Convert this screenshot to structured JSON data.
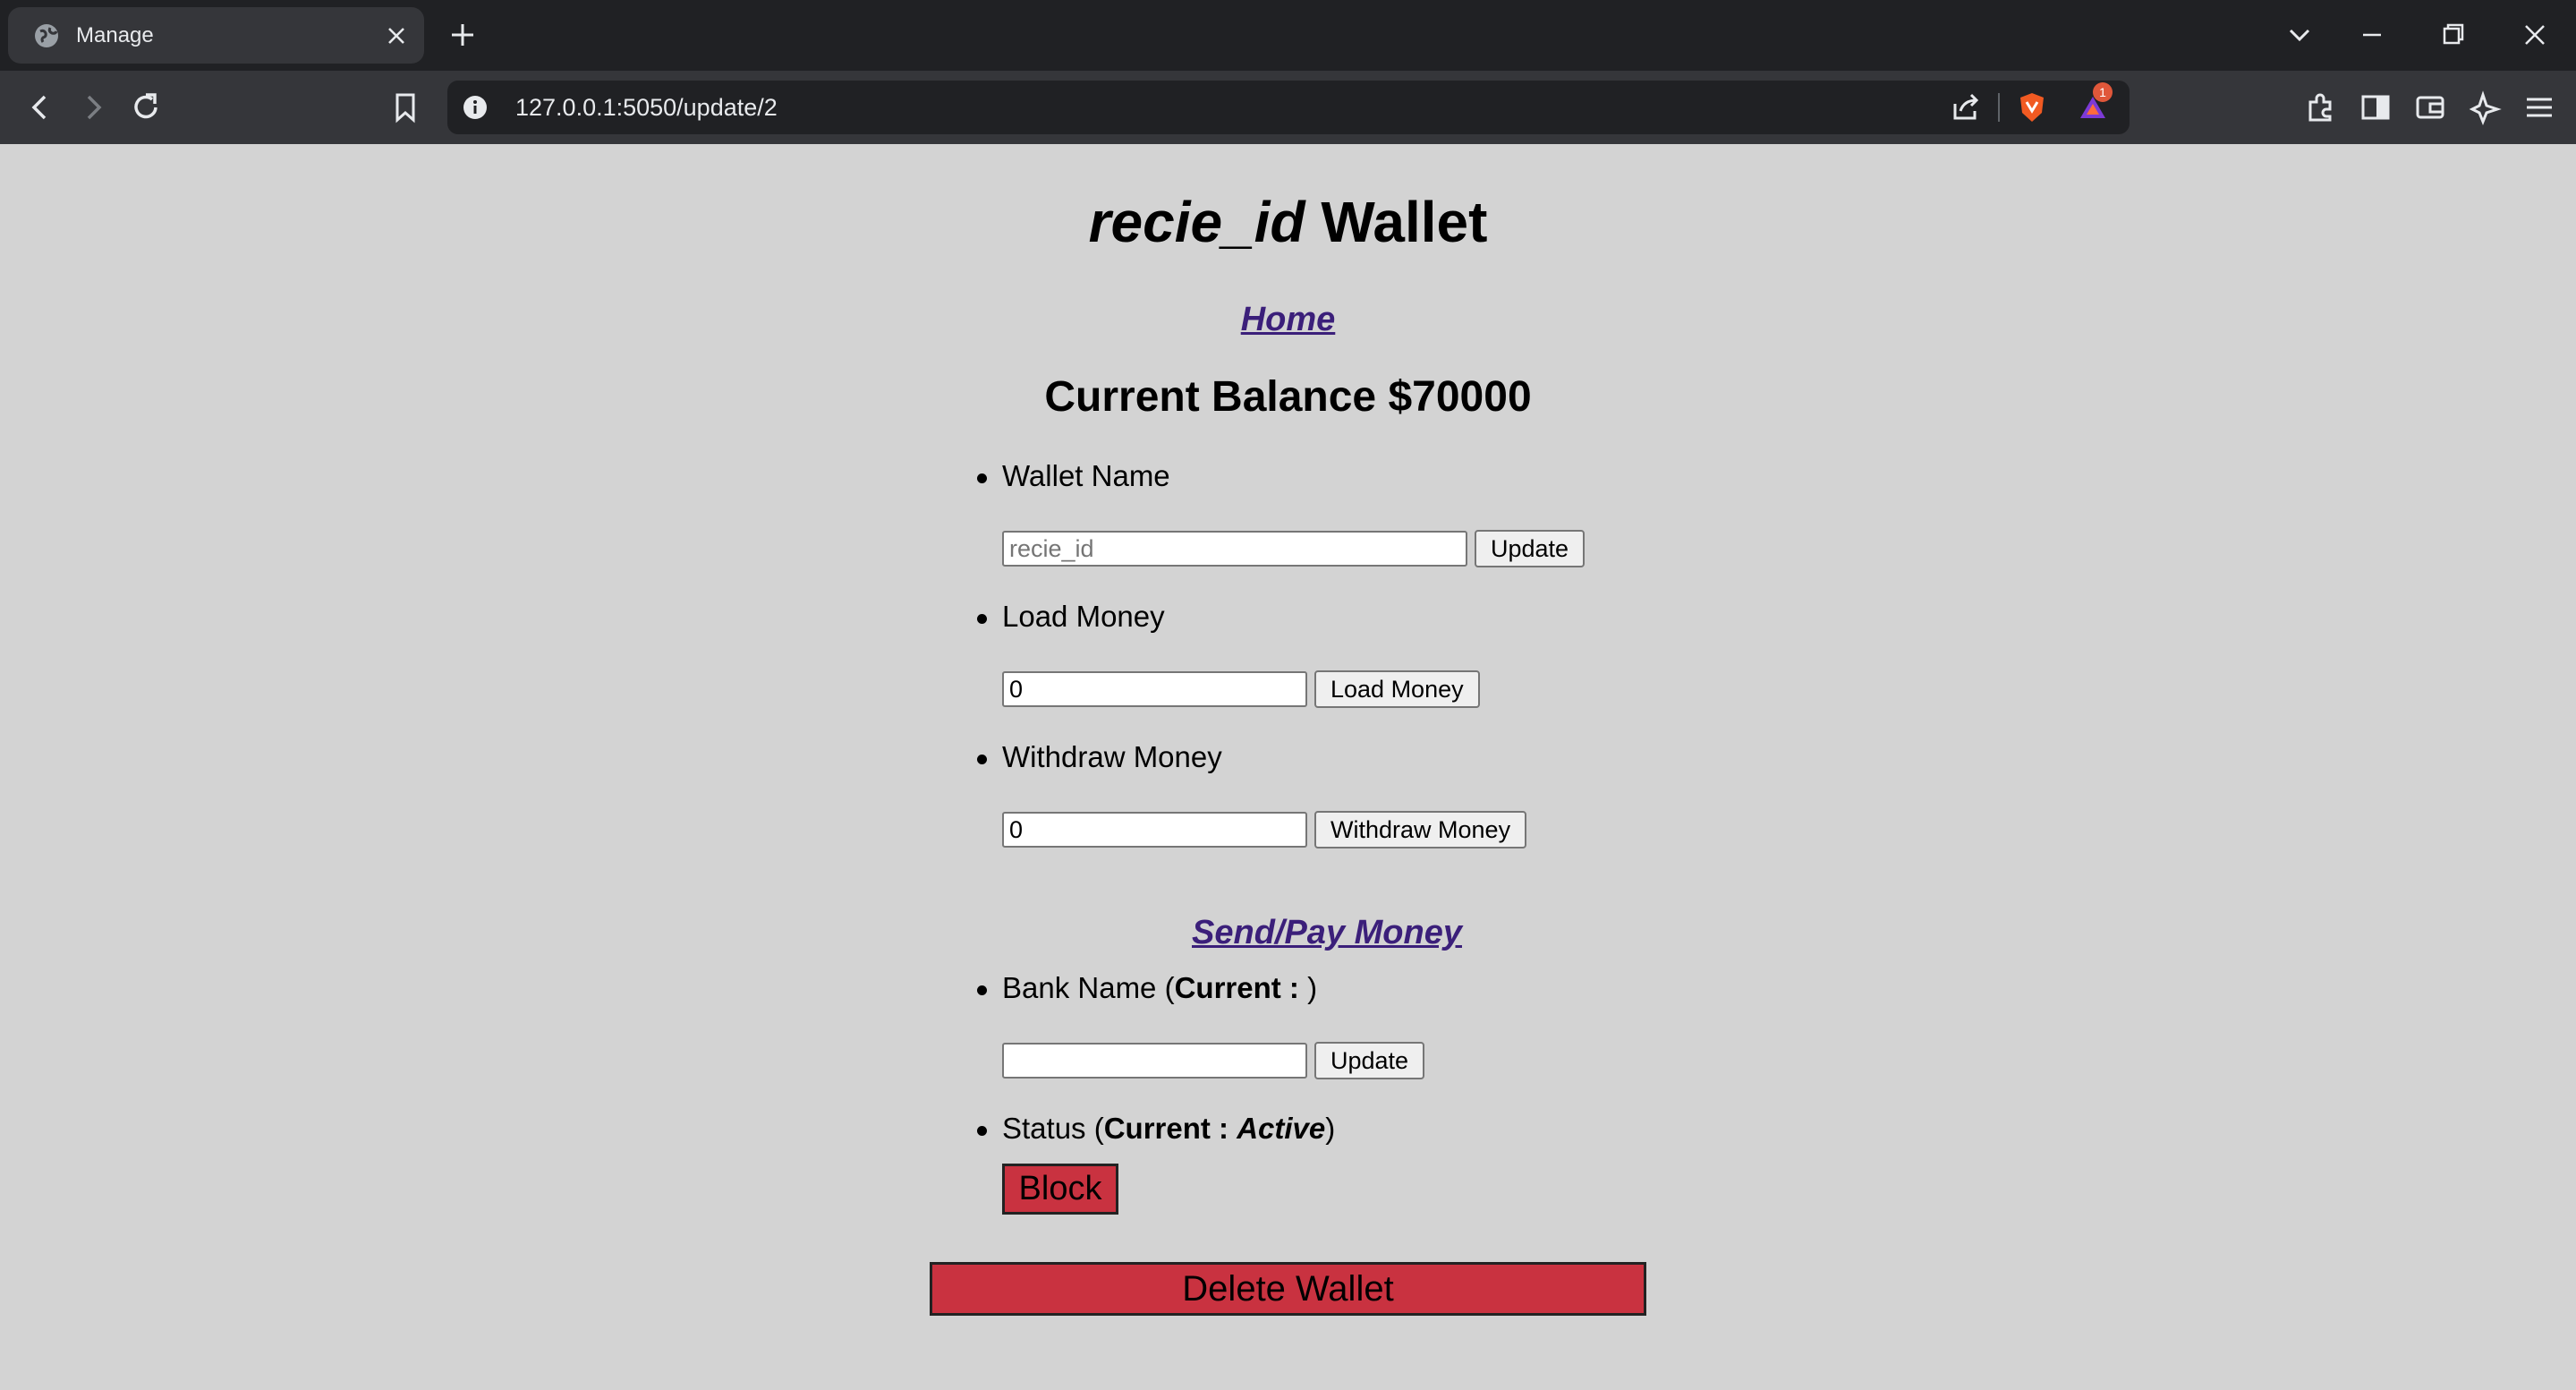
{
  "browser": {
    "tab_title": "Manage",
    "url": "127.0.0.1:5050/update/2",
    "notification_badge": "1"
  },
  "page": {
    "wallet_name": "recie_id",
    "title_suffix": "Wallet",
    "home_link": "Home",
    "balance_text": "Current Balance $70000",
    "wallet_name_section": {
      "label": "Wallet Name",
      "placeholder": "recie_id",
      "button": "Update"
    },
    "load_money_section": {
      "label": "Load Money",
      "value": "0",
      "button": "Load Money"
    },
    "withdraw_money_section": {
      "label": "Withdraw Money",
      "value": "0",
      "button": "Withdraw Money"
    },
    "send_pay_link": "Send/Pay Money",
    "bank_name_section": {
      "label": "Bank Name (",
      "current_label": "Current : ",
      "current_value": "",
      "closing": ")",
      "value": "",
      "button": "Update"
    },
    "status_section": {
      "label": "Status (",
      "current_label": "Current : ",
      "current_value": "Active",
      "closing": ")",
      "button": "Block"
    },
    "delete_button": "Delete Wallet"
  },
  "colors": {
    "page_bg": "#d3d3d3",
    "link": "#3b1f7a",
    "danger": "#c93240"
  }
}
